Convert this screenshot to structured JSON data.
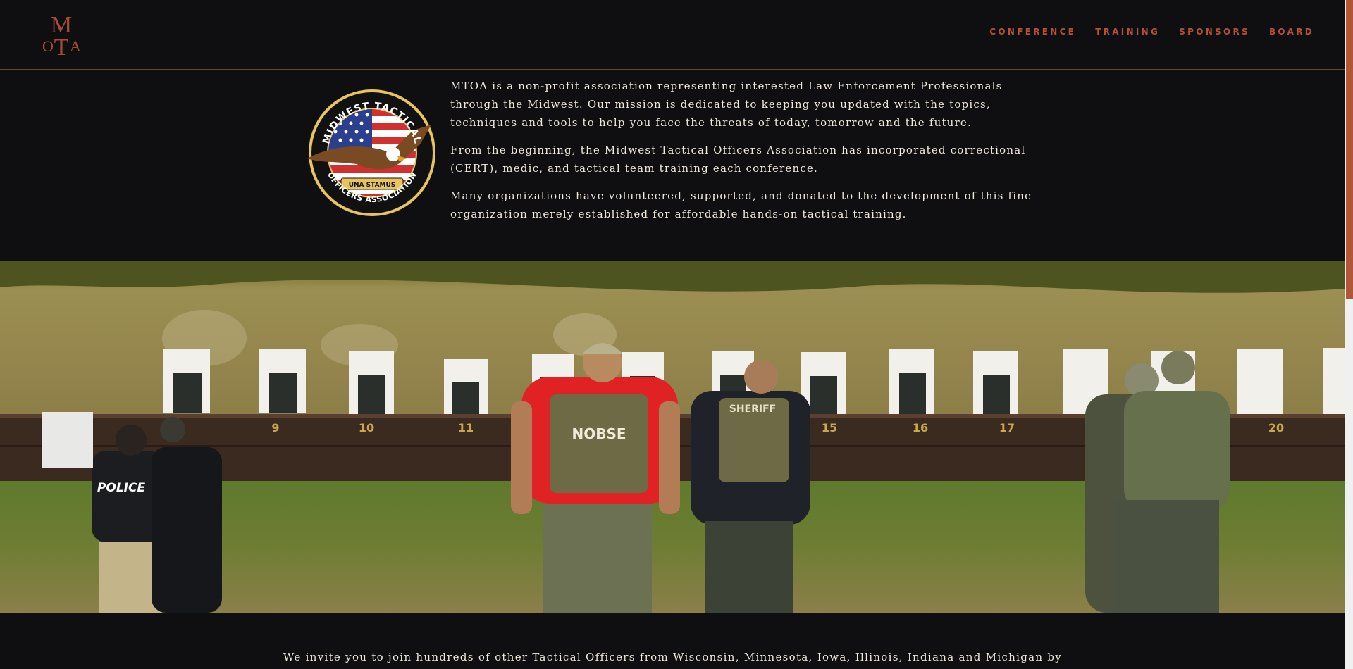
{
  "header": {
    "logo_alt": "MTOA",
    "nav": [
      {
        "label": "CONFERENCE"
      },
      {
        "label": "TRAINING"
      },
      {
        "label": "SPONSORS"
      },
      {
        "label": "BOARD"
      }
    ]
  },
  "intro": {
    "badge": {
      "top_text": "MIDWEST TACTICAL",
      "bottom_text": "OFFICERS ASSOCIATION",
      "banner_text": "UNA STAMUS"
    },
    "paragraphs": [
      "MTOA is a non-profit association representing interested Law Enforcement Professionals through the Midwest. Our mission is dedicated to keeping you updated with the topics, techniques and tools to help you face the threats of today, tomorrow and the future.",
      "From the beginning, the Midwest Tactical Officers Association has incorporated correctional (CERT), medic, and tactical team training each conference.",
      "Many organizations have volunteered, supported, and donated to the development of this fine organization merely established for affordable hands-on tactical training."
    ]
  },
  "hero": {
    "lane_numbers": [
      "9",
      "10",
      "11",
      "15",
      "16",
      "17",
      "20"
    ],
    "vest_labels": [
      "POLICE",
      "NOBSE",
      "SHERIFF"
    ]
  },
  "footer": {
    "invite_text": "We invite you to join hundreds of other Tactical Officers from Wisconsin, Minnesota, Iowa, Illinois, Indiana and Michigan by"
  },
  "colors": {
    "background": "#0f0f11",
    "accent": "#b65038",
    "text": "#eee8db"
  }
}
